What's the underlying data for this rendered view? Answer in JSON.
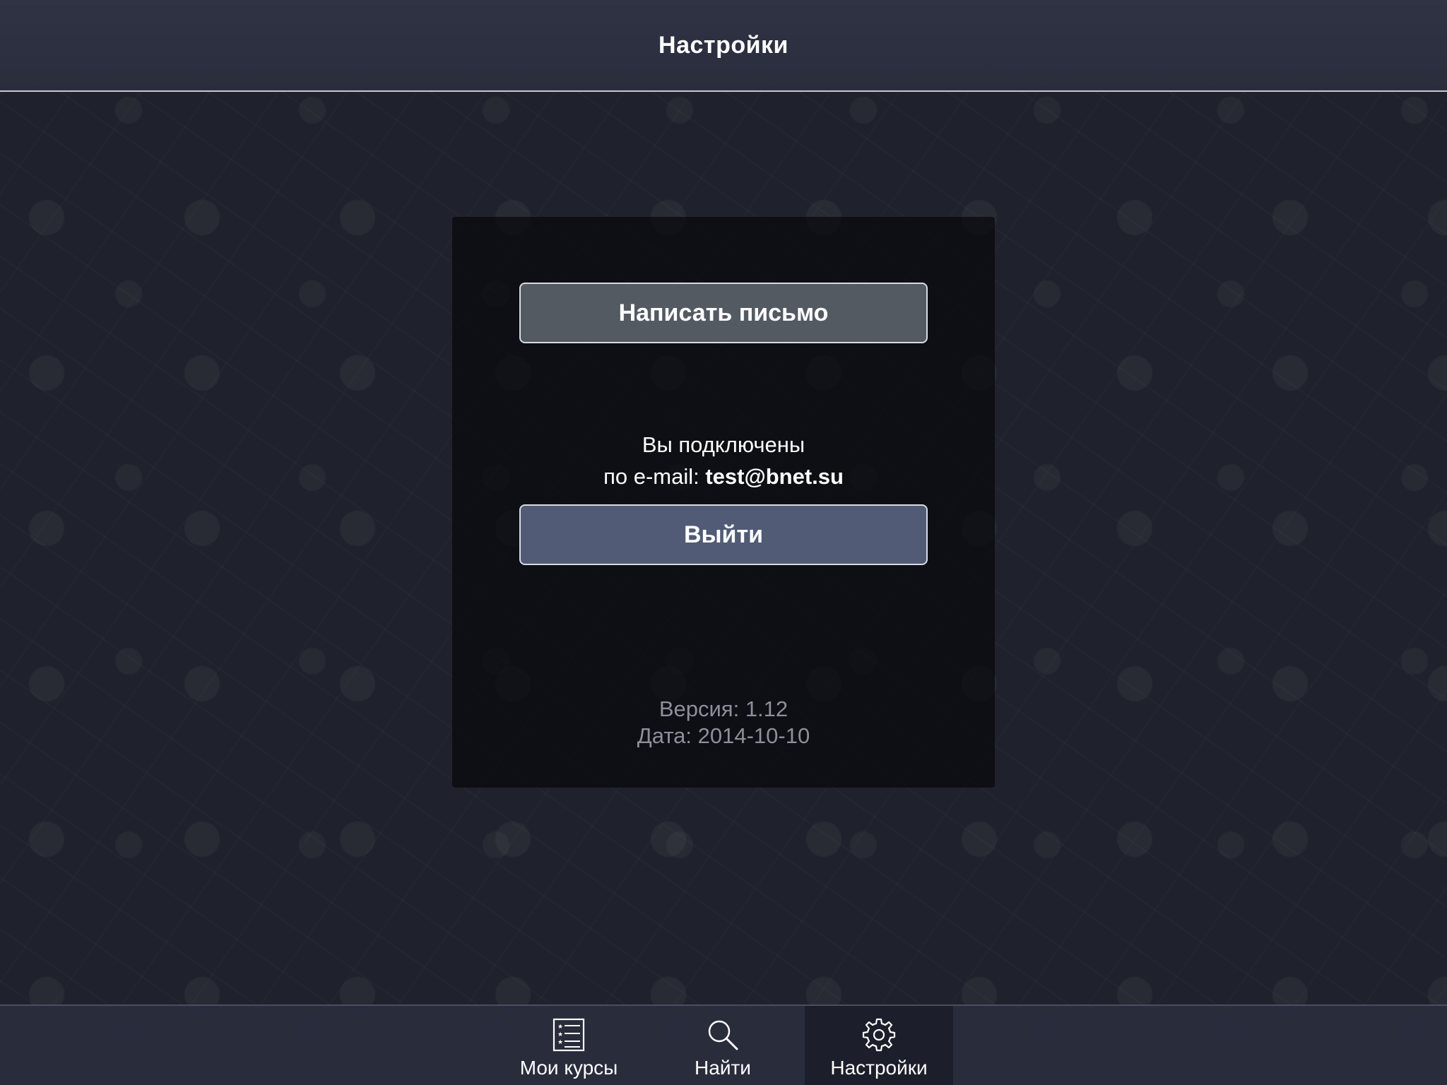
{
  "navbar": {
    "title": "Настройки"
  },
  "panel": {
    "write_button_label": "Написать письмо",
    "connected_line1": "Вы подключены",
    "connected_prefix": "по e-mail: ",
    "email": "test@bnet.su",
    "logout_button_label": "Выйти",
    "version_text": "Версия: 1.12",
    "date_text": "Дата: 2014-10-10"
  },
  "tabbar": {
    "tabs": [
      {
        "label": "Мои курсы",
        "icon": "course-list-icon",
        "active": false
      },
      {
        "label": "Найти",
        "icon": "search-icon",
        "active": false
      },
      {
        "label": "Настройки",
        "icon": "gear-icon",
        "active": true
      }
    ]
  },
  "colors": {
    "background": "#1f222c",
    "navbar": "#2f3344",
    "write_button": "#545a61",
    "logout_button": "#515b76",
    "active_tab": "#1c1f2b",
    "version_text": "#8d9099"
  }
}
